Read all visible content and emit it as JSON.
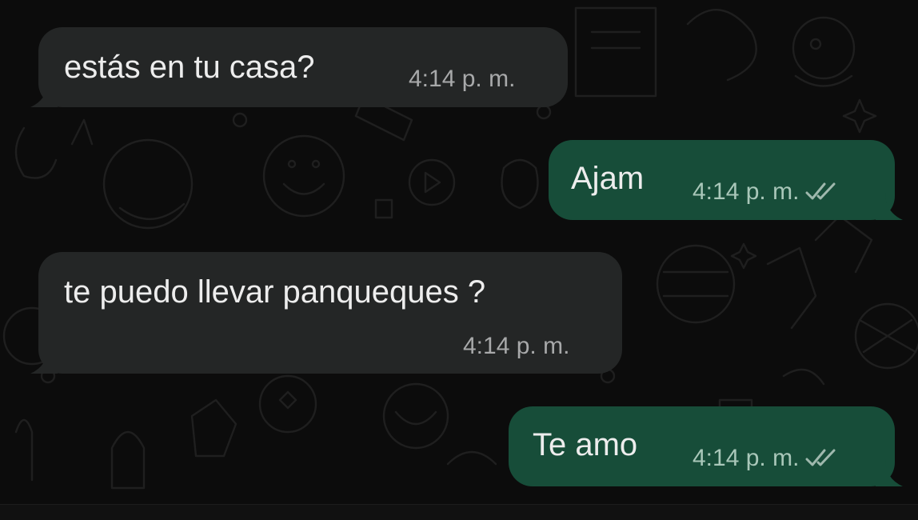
{
  "chat": {
    "messages": [
      {
        "direction": "incoming",
        "text": "estás en tu casa?",
        "time": "4:14 p. m."
      },
      {
        "direction": "outgoing",
        "text": "Ajam",
        "time": "4:14 p. m.",
        "status_icon": "double-check-icon"
      },
      {
        "direction": "incoming",
        "text": "te puedo llevar panqueques ?",
        "time": "4:14 p. m."
      },
      {
        "direction": "outgoing",
        "text": "Te amo",
        "time": "4:14 p. m.",
        "status_icon": "double-check-icon"
      }
    ]
  },
  "colors": {
    "background": "#0c0c0c",
    "incoming_bubble": "#242626",
    "outgoing_bubble": "#174d39",
    "text": "#ededed",
    "timestamp": "#a8a9aa"
  }
}
